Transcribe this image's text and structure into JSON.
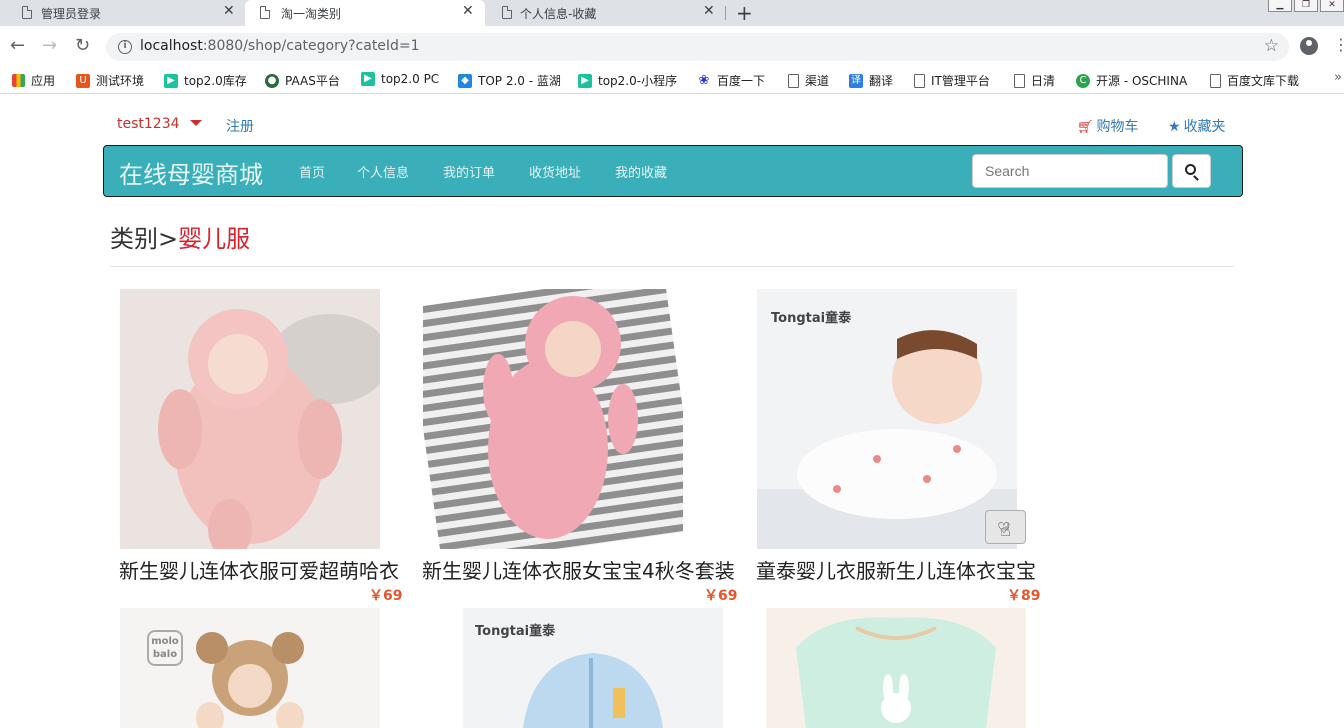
{
  "browser": {
    "tabs": [
      {
        "title": "管理员登录",
        "active": false
      },
      {
        "title": "淘一淘类别",
        "active": true
      },
      {
        "title": "个人信息-收藏",
        "active": false
      }
    ],
    "new_tab": "+",
    "url_host": "localhost",
    "url_path": ":8080/shop/category?cateId=1",
    "bookmarks": [
      {
        "label": "应用",
        "icon": "apps-grid-icon"
      },
      {
        "label": "测试环境",
        "icon": "u-brand-icon"
      },
      {
        "label": "top2.0库存",
        "icon": "play-green-icon"
      },
      {
        "label": "PAAS平台",
        "icon": "globe-icon"
      },
      {
        "label": "top2.0 PC",
        "icon": "play-green-icon"
      },
      {
        "label": "TOP 2.0 - 蓝湖",
        "icon": "lanhu-icon"
      },
      {
        "label": "top2.0-小程序",
        "icon": "play-green-icon"
      },
      {
        "label": "百度一下",
        "icon": "paw-icon"
      },
      {
        "label": "渠道",
        "icon": "doc-icon"
      },
      {
        "label": "翻译",
        "icon": "translate-icon"
      },
      {
        "label": "IT管理平台",
        "icon": "doc-icon"
      },
      {
        "label": "日清",
        "icon": "doc-icon"
      },
      {
        "label": "开源 - OSCHINA",
        "icon": "oschina-icon"
      },
      {
        "label": "百度文库下载",
        "icon": "doc-icon"
      }
    ],
    "bookmarks_more": "»"
  },
  "header": {
    "username": "test1234",
    "register": "注册",
    "cart": "购物车",
    "favorites": "收藏夹"
  },
  "navbar": {
    "brand": "在线母婴商城",
    "links": [
      "首页",
      "个人信息",
      "我的订单",
      "收货地址",
      "我的收藏"
    ],
    "search_placeholder": "Search",
    "color": "#3aafb9"
  },
  "breadcrumb": {
    "prefix": "类别>",
    "category": "婴儿服"
  },
  "products": [
    {
      "name": "新生婴儿连体衣服可爱超萌哈衣",
      "price": "￥69"
    },
    {
      "name": "新生婴儿连体衣服女宝宝4秋冬套装",
      "price": "￥69"
    },
    {
      "name": "童泰婴儿衣服新生儿连体衣宝宝",
      "price": "￥89",
      "brand_mark": "Tongtai童泰"
    },
    {
      "brand_mark": "molo balo"
    },
    {
      "brand_mark": "Tongtai童泰"
    },
    {}
  ]
}
